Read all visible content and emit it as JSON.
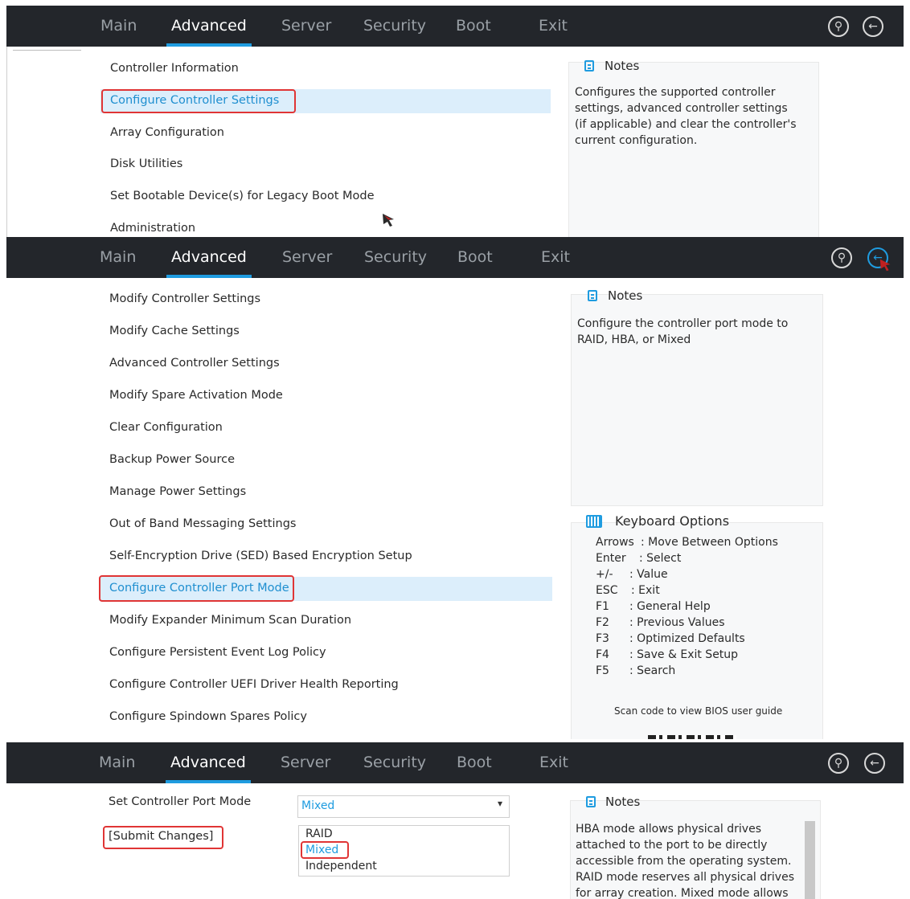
{
  "nav": {
    "tabs": [
      "Main",
      "Advanced",
      "Server",
      "Security",
      "Boot",
      "Exit"
    ],
    "active_tab": "Advanced",
    "icons": [
      "search-icon",
      "back-icon"
    ]
  },
  "screen1": {
    "menu": [
      "Controller Information",
      "Configure Controller Settings",
      "Array Configuration",
      "Disk Utilities",
      "Set Bootable Device(s) for Legacy Boot Mode",
      "Administration"
    ],
    "selected_index": 1,
    "notes_title": "Notes",
    "notes_lines": [
      "Configures the supported controller",
      "settings, advanced controller settings",
      "(if applicable) and clear the controller's",
      "current configuration."
    ]
  },
  "screen2": {
    "menu": [
      "Modify Controller Settings",
      "Modify Cache Settings",
      "Advanced Controller Settings",
      "Modify Spare Activation Mode",
      "Clear Configuration",
      "Backup Power Source",
      "Manage Power Settings",
      "Out of Band Messaging Settings",
      "Self-Encryption Drive (SED) Based Encryption Setup",
      "Configure Controller Port Mode",
      "Modify Expander Minimum Scan Duration",
      "Configure Persistent Event Log Policy",
      "Configure Controller UEFI Driver Health Reporting",
      "Configure Spindown Spares Policy"
    ],
    "selected_index": 9,
    "notes_title": "Notes",
    "notes_lines": [
      "Configure the controller port mode to",
      "RAID, HBA, or Mixed"
    ],
    "keyboard_title": "Keyboard Options",
    "keyboard": [
      {
        "key": "Arrows",
        "desc": ": Move Between Options"
      },
      {
        "key": "Enter",
        "desc": ": Select"
      },
      {
        "key": "+/-",
        "desc": ": Value"
      },
      {
        "key": "ESC",
        "desc": ": Exit"
      },
      {
        "key": "F1",
        "desc": ": General Help"
      },
      {
        "key": "F2",
        "desc": ": Previous Values"
      },
      {
        "key": "F3",
        "desc": ": Optimized Defaults"
      },
      {
        "key": "F4",
        "desc": ": Save & Exit Setup"
      },
      {
        "key": "F5",
        "desc": ": Search"
      }
    ],
    "scan_text": "Scan code to view BIOS user guide"
  },
  "screen3": {
    "port_mode_label": "Set Controller Port Mode",
    "port_mode_value": "Mixed",
    "submit_label": "[Submit Changes]",
    "options": [
      "RAID",
      "Mixed",
      "Independent"
    ],
    "selected_option": "Mixed",
    "notes_title": "Notes",
    "notes_lines": [
      "HBA mode allows physical drives",
      "attached to the port to be directly",
      "accessible from the operating system.",
      "RAID mode reserves all physical drives",
      "for array creation. Mixed mode allows"
    ]
  },
  "colors": {
    "topbar": "#23262b",
    "accent": "#1f9ce0",
    "highlight_row": "#dceefb",
    "annotation_red": "#e03535"
  }
}
